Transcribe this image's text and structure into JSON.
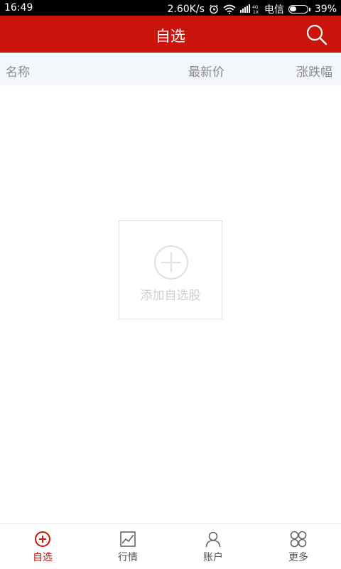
{
  "status_bar": {
    "time": "16:49",
    "speed": "2.60K/s",
    "network": "4G\n1X",
    "carrier": "电信",
    "battery": "39%",
    "battery_level": 0.39,
    "icons": [
      "alarm-icon",
      "wifi-icon",
      "signal-icon",
      "battery-icon"
    ]
  },
  "header": {
    "title": "自选",
    "search_icon": "search-icon"
  },
  "columns": {
    "name": "名称",
    "price": "最新价",
    "change": "涨跌幅"
  },
  "add_card": {
    "label": "添加自选股",
    "icon": "plus-circle-icon"
  },
  "bottom_nav": {
    "items": [
      {
        "label": "自选",
        "icon": "plus-circle-icon",
        "active": true
      },
      {
        "label": "行情",
        "icon": "chart-icon",
        "active": false
      },
      {
        "label": "账户",
        "icon": "person-icon",
        "active": false
      },
      {
        "label": "更多",
        "icon": "grid-icon",
        "active": false
      }
    ]
  },
  "colors": {
    "brand_red": "#c9150c",
    "header_row_bg": "#f3f6fa",
    "muted_text": "#8a8a8a"
  }
}
